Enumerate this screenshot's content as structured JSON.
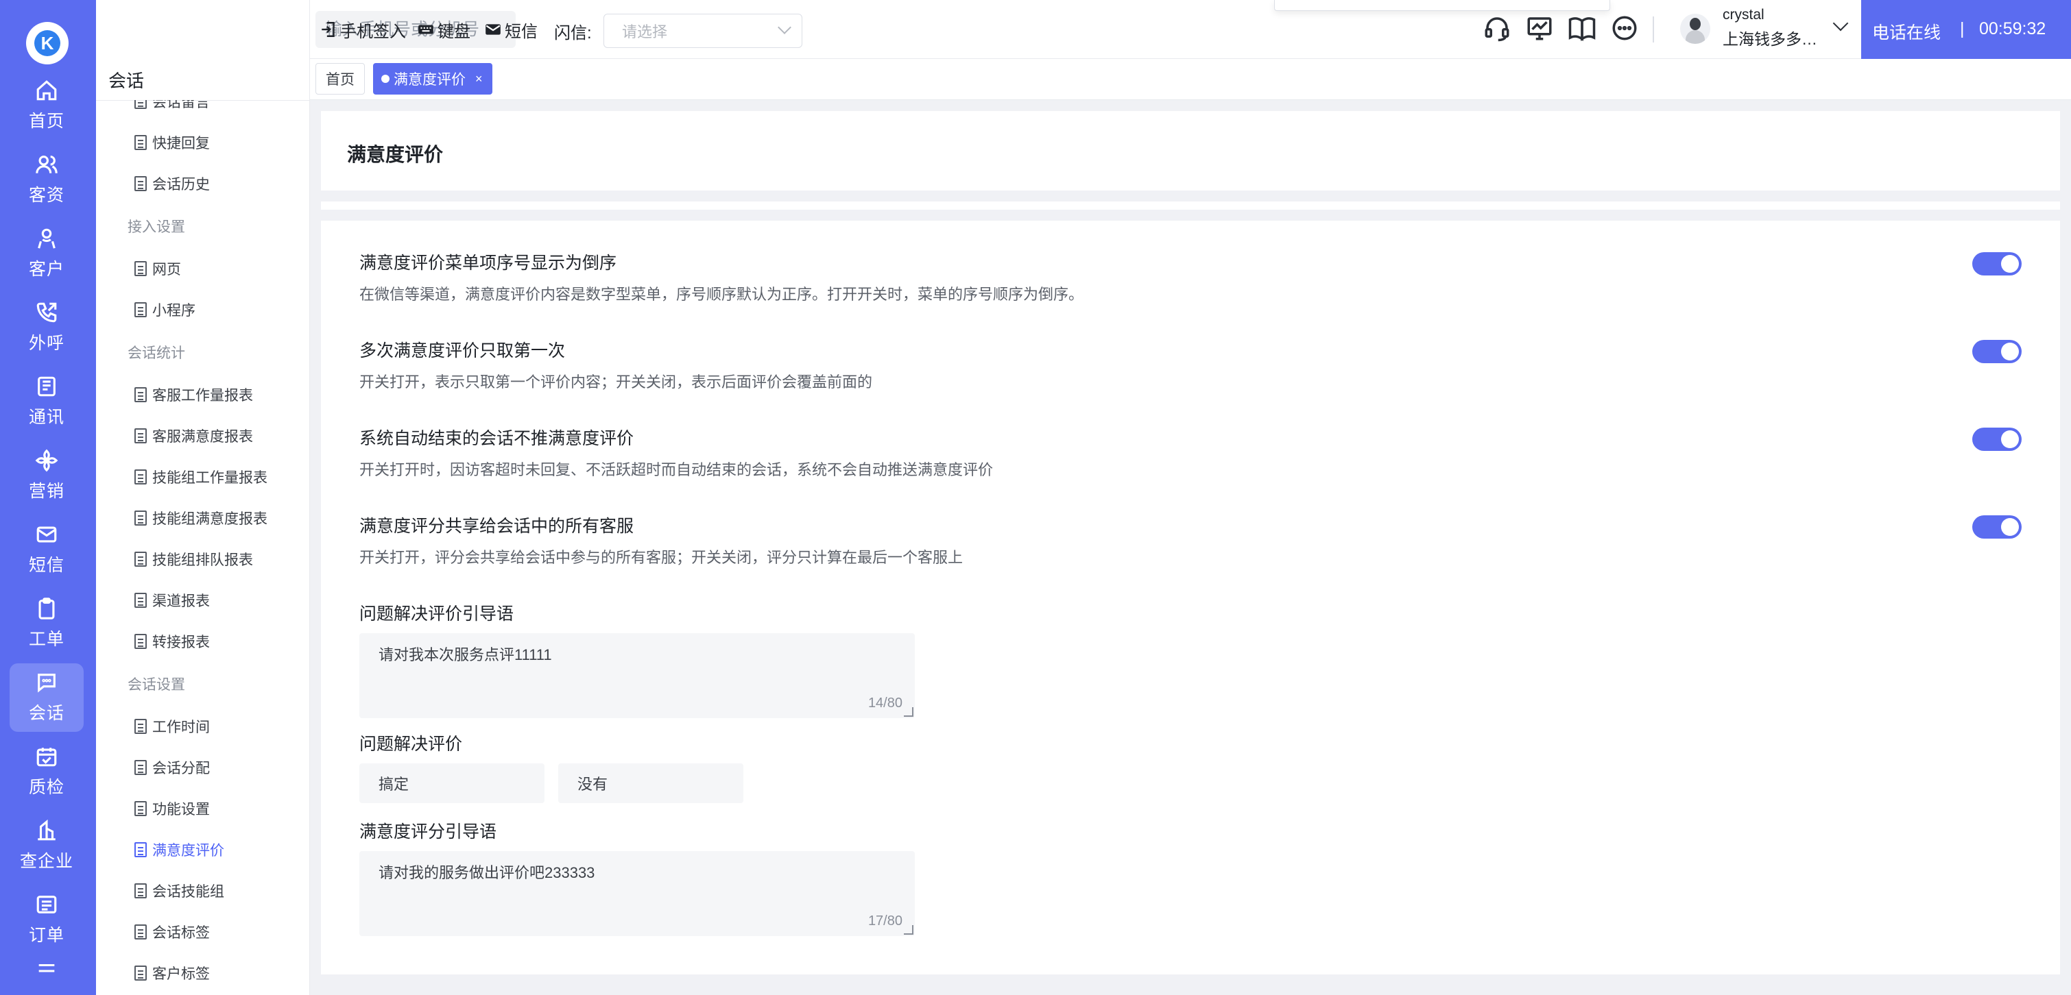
{
  "app": {
    "logo_letter": "K"
  },
  "rail": [
    {
      "label": "首页",
      "icon": "home-icon"
    },
    {
      "label": "客资",
      "icon": "users-icon"
    },
    {
      "label": "客户",
      "icon": "user-icon"
    },
    {
      "label": "外呼",
      "icon": "phone-out-icon"
    },
    {
      "label": "通讯",
      "icon": "contacts-icon"
    },
    {
      "label": "营销",
      "icon": "marketing-icon"
    },
    {
      "label": "短信",
      "icon": "sms-icon"
    },
    {
      "label": "工单",
      "icon": "clipboard-icon"
    },
    {
      "label": "会话",
      "icon": "chat-icon",
      "active": true
    },
    {
      "label": "质检",
      "icon": "calendar-check-icon"
    },
    {
      "label": "查企业",
      "icon": "building-icon"
    },
    {
      "label": "订单",
      "icon": "list-icon"
    }
  ],
  "tree": {
    "title": "会话",
    "rows": [
      {
        "type": "leaf",
        "label": "会话留言"
      },
      {
        "type": "leaf",
        "label": "快捷回复"
      },
      {
        "type": "leaf",
        "label": "会话历史"
      },
      {
        "type": "group",
        "label": "接入设置"
      },
      {
        "type": "leaf",
        "label": "网页"
      },
      {
        "type": "leaf",
        "label": "小程序"
      },
      {
        "type": "group",
        "label": "会话统计"
      },
      {
        "type": "leaf",
        "label": "客服工作量报表"
      },
      {
        "type": "leaf",
        "label": "客服满意度报表"
      },
      {
        "type": "leaf",
        "label": "技能组工作量报表"
      },
      {
        "type": "leaf",
        "label": "技能组满意度报表"
      },
      {
        "type": "leaf",
        "label": "技能组排队报表"
      },
      {
        "type": "leaf",
        "label": "渠道报表"
      },
      {
        "type": "leaf",
        "label": "转接报表"
      },
      {
        "type": "group",
        "label": "会话设置"
      },
      {
        "type": "leaf",
        "label": "工作时间"
      },
      {
        "type": "leaf",
        "label": "会话分配"
      },
      {
        "type": "leaf",
        "label": "功能设置"
      },
      {
        "type": "leaf",
        "label": "满意度评价",
        "active": true
      },
      {
        "type": "leaf",
        "label": "会话技能组"
      },
      {
        "type": "leaf",
        "label": "会话标签"
      },
      {
        "type": "leaf",
        "label": "客户标签"
      }
    ]
  },
  "topbar": {
    "search_placeholder": "输入手机号或分机号",
    "phone_checkin": "手机签入",
    "keyboard": "键盘",
    "sms": "短信",
    "flash_label": "闪信:",
    "flash_placeholder": "请选择",
    "user_name": "crystal",
    "user_company": "上海钱多多功能测试",
    "status": "电话在线",
    "status_sep": "|",
    "timer": "00:59:32"
  },
  "tabs": {
    "home": "首页",
    "current": "满意度评价",
    "close": "×"
  },
  "page": {
    "title": "满意度评价",
    "settings": [
      {
        "title": "满意度评价菜单项序号显示为倒序",
        "desc": "在微信等渠道，满意度评价内容是数字型菜单，序号顺序默认为正序。打开开关时，菜单的序号顺序为倒序。",
        "on": true
      },
      {
        "title": "多次满意度评价只取第一次",
        "desc": "开关打开，表示只取第一个评价内容；开关关闭，表示后面评价会覆盖前面的",
        "on": true
      },
      {
        "title": "系统自动结束的会话不推满意度评价",
        "desc": "开关打开时，因访客超时未回复、不活跃超时而自动结束的会话，系统不会自动推送满意度评价",
        "on": true
      },
      {
        "title": "满意度评分共享给会话中的所有客服",
        "desc": "开关打开，评分会共享给会话中参与的所有客服；开关关闭，评分只计算在最后一个客服上",
        "on": true
      }
    ],
    "resolve_prompt_label": "问题解决评价引导语",
    "resolve_prompt_value": "请对我本次服务点评11111",
    "resolve_prompt_count": "14/80",
    "resolve_label": "问题解决评价",
    "resolve_options": [
      "搞定",
      "没有"
    ],
    "score_prompt_label": "满意度评分引导语",
    "score_prompt_value": "请对我的服务做出评价吧233333",
    "score_prompt_count": "17/80"
  }
}
